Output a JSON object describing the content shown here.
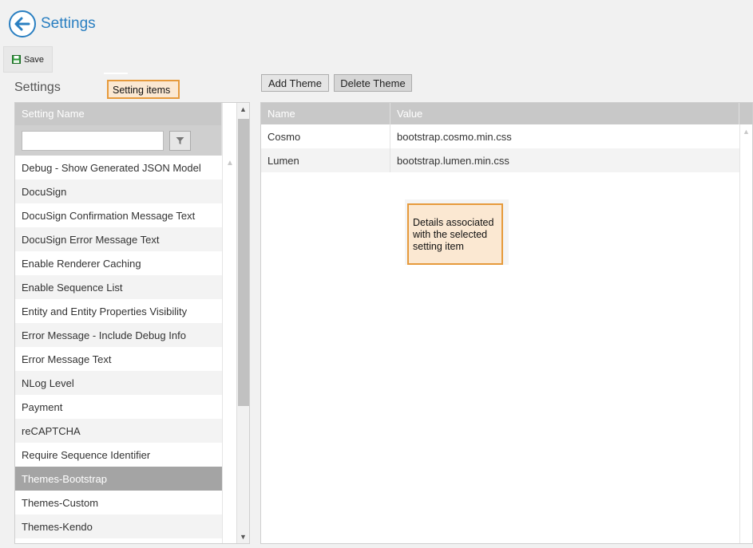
{
  "header": {
    "title": "Settings",
    "back_icon": "arrow-left-circle-icon"
  },
  "toolbar": {
    "save_label": "Save",
    "save_icon": "floppy-disk-icon"
  },
  "left": {
    "title": "Settings",
    "callout": "Setting items",
    "column_header": "Setting Name",
    "filter_value": "",
    "filter_icon": "funnel-icon",
    "items": [
      "Debug - Show Generated JSON Model",
      "DocuSign",
      "DocuSign Confirmation Message Text",
      "DocuSign Error Message Text",
      "Enable Renderer Caching",
      "Enable Sequence List",
      "Entity and Entity Properties Visibility",
      "Error Message - Include Debug Info",
      "Error Message Text",
      "NLog Level",
      "Payment",
      "reCAPTCHA",
      "Require Sequence Identifier",
      "Themes-Bootstrap",
      "Themes-Custom",
      "Themes-Kendo"
    ],
    "selected_item": "Themes-Bootstrap"
  },
  "right": {
    "add_label": "Add Theme",
    "delete_label": "Delete Theme",
    "columns": [
      "Name",
      "Value"
    ],
    "rows": [
      {
        "name": "Cosmo",
        "value": "bootstrap.cosmo.min.css"
      },
      {
        "name": "Lumen",
        "value": "bootstrap.lumen.min.css"
      }
    ],
    "callout": "Details associated with the selected setting item"
  },
  "colors": {
    "accent": "#2a7fc1",
    "callout_fill": "#fbe8d2",
    "callout_border": "#e69a3c",
    "selected_row": "#a4a4a4"
  }
}
